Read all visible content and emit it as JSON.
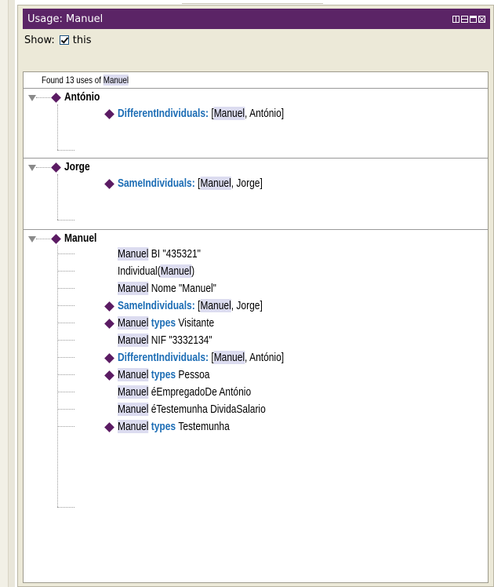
{
  "panel": {
    "title": "Usage: Manuel",
    "show_label": "Show:",
    "show_checkbox_label": "this",
    "show_checked": true
  },
  "found": {
    "prefix": "Found 13 uses of ",
    "name": "Manuel"
  },
  "groups": [
    {
      "header": "António",
      "rows": [
        {
          "diamond": true,
          "keyword": "DifferentIndividuals:",
          "open": " [",
          "a": "Manuel",
          "sep": ", ",
          "b": "António",
          "close": "]"
        }
      ]
    },
    {
      "header": "Jorge",
      "rows": [
        {
          "diamond": true,
          "keyword": "SameIndividuals:",
          "open": " [",
          "a": "Manuel",
          "sep": ", ",
          "b": "Jorge",
          "close": "]"
        }
      ]
    },
    {
      "header": "Manuel",
      "rows": [
        {
          "subject": "Manuel",
          "rest": " BI \"435321\""
        },
        {
          "pre": "Individual(",
          "subject": "Manuel",
          "rest": ")"
        },
        {
          "subject": "Manuel",
          "rest": " Nome \"Manuel\""
        },
        {
          "keyword": "SameIndividuals:",
          "open": " [",
          "a": "Manuel",
          "sep": ", ",
          "b": "Jorge",
          "close": "]"
        },
        {
          "subject": "Manuel",
          "kw2": " types ",
          "rest": "Visitante"
        },
        {
          "subject": "Manuel",
          "rest": " NIF \"3332134\""
        },
        {
          "keyword": "DifferentIndividuals:",
          "open": " [",
          "a": "Manuel",
          "sep": ", ",
          "b": "António",
          "close": "]"
        },
        {
          "subject": "Manuel",
          "kw2": " types ",
          "rest": "Pessoa"
        },
        {
          "subject": "Manuel",
          "rest": " éEmpregadoDe António"
        },
        {
          "subject": "Manuel",
          "rest": " éTestemunha DividaSalario"
        },
        {
          "subject": "Manuel",
          "kw2": " types ",
          "rest": "Testemunha"
        }
      ]
    }
  ],
  "colors": {
    "titlebar": "#5b2466",
    "diamond": "#5b1b63",
    "keyword": "#1c6db5",
    "highlight": "#dcdcf0"
  }
}
